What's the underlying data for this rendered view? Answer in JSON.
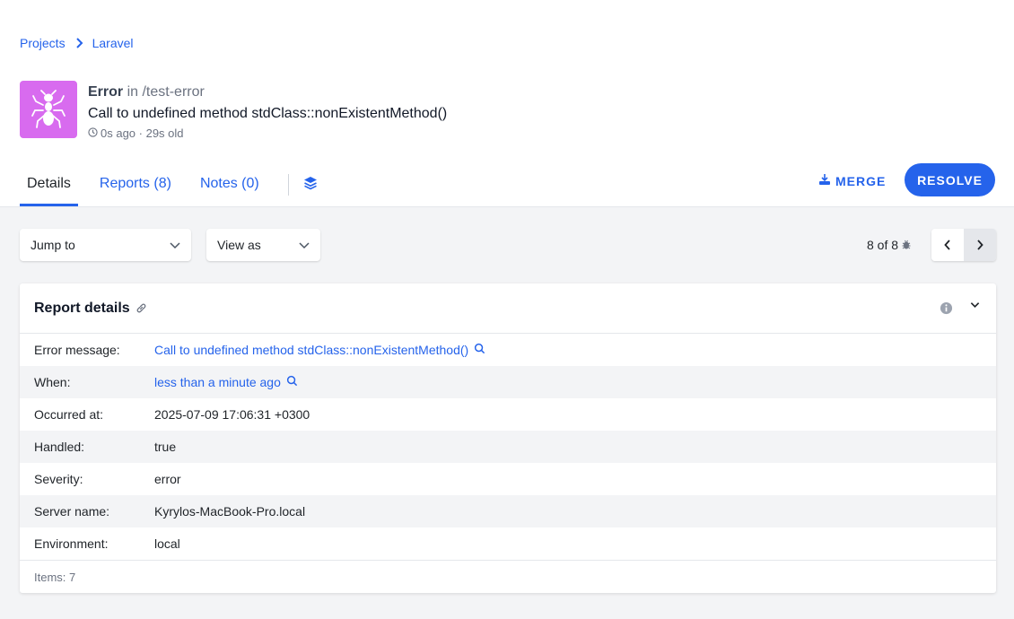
{
  "breadcrumb": {
    "projects": "Projects",
    "project": "Laravel"
  },
  "error": {
    "type": "Error",
    "location": "in /test-error",
    "message": "Call to undefined method stdClass::nonExistentMethod()",
    "time": "0s ago · 29s old",
    "icon_color": "#d86bef"
  },
  "tabs": {
    "details": "Details",
    "reports": "Reports (8)",
    "notes": "Notes (0)"
  },
  "actions": {
    "merge": "MERGE",
    "resolve": "RESOLVE"
  },
  "toolbar": {
    "jump_to": "Jump to",
    "view_as": "View as",
    "counter": "8 of 8"
  },
  "report": {
    "title": "Report details",
    "rows": [
      {
        "key": "Error message:",
        "value": "Call to undefined method stdClass::nonExistentMethod()"
      },
      {
        "key": "When:",
        "value": "less than a minute ago"
      },
      {
        "key": "Occurred at:",
        "value": "2025-07-09 17:06:31 +0300"
      },
      {
        "key": "Handled:",
        "value": "true"
      },
      {
        "key": "Severity:",
        "value": "error"
      },
      {
        "key": "Server name:",
        "value": "Kyrylos-MacBook-Pro.local"
      },
      {
        "key": "Environment:",
        "value": "local"
      }
    ],
    "footer": "Items: 7"
  },
  "accent": "#2563eb"
}
